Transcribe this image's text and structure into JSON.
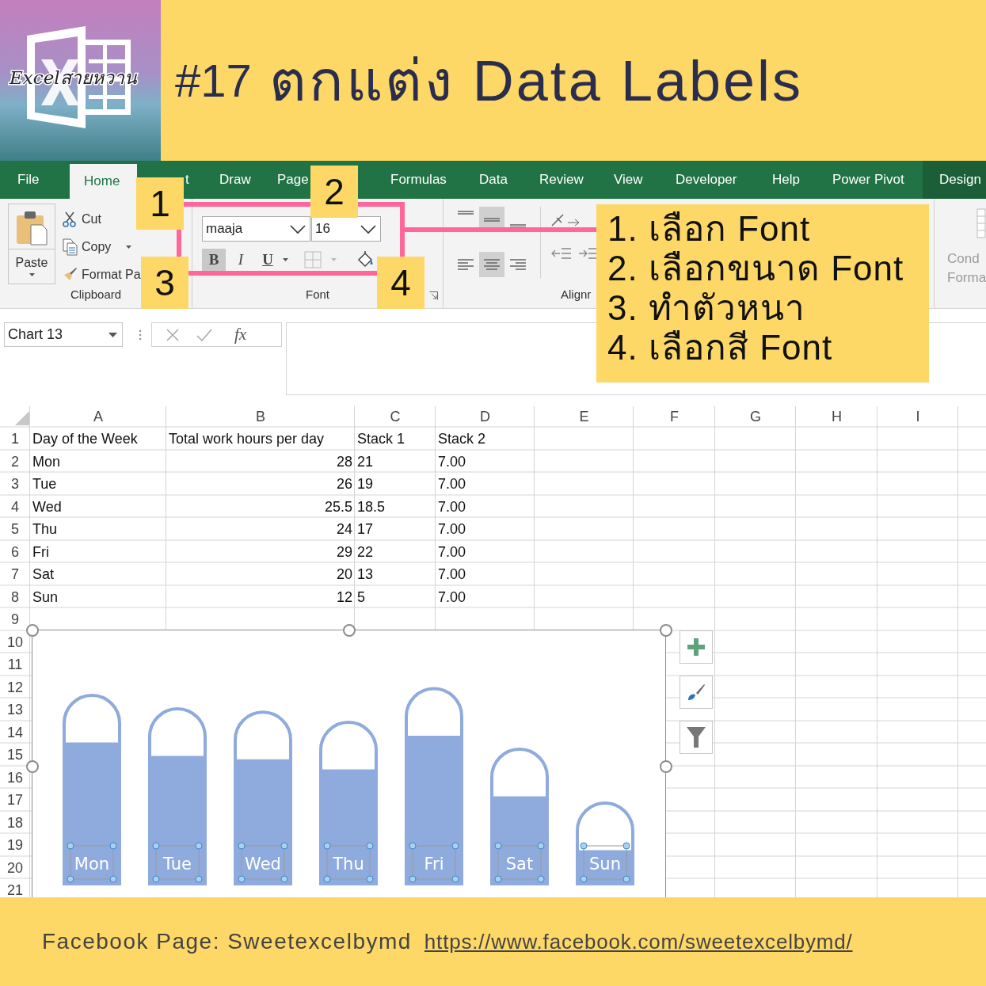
{
  "header": {
    "logo_text": "Excelสายหวาน",
    "number": "#17",
    "title": "ตกแต่ง Data Labels"
  },
  "ribbon": {
    "tabs": [
      {
        "label": "File",
        "selected": false,
        "contextual": false
      },
      {
        "label": "Home",
        "selected": true,
        "contextual": false
      },
      {
        "label": "t",
        "selected": false,
        "contextual": false
      },
      {
        "label": "Draw",
        "selected": false,
        "contextual": false
      },
      {
        "label": "Page",
        "selected": false,
        "contextual": false
      },
      {
        "label": "Formulas",
        "selected": false,
        "contextual": false
      },
      {
        "label": "Data",
        "selected": false,
        "contextual": false
      },
      {
        "label": "Review",
        "selected": false,
        "contextual": false
      },
      {
        "label": "View",
        "selected": false,
        "contextual": false
      },
      {
        "label": "Developer",
        "selected": false,
        "contextual": false
      },
      {
        "label": "Help",
        "selected": false,
        "contextual": false
      },
      {
        "label": "Power Pivot",
        "selected": false,
        "contextual": false
      },
      {
        "label": "Design",
        "selected": false,
        "contextual": true
      }
    ],
    "clipboard": {
      "paste": "Paste",
      "cut": "Cut",
      "copy": "Copy",
      "format_painter": "Format Pa",
      "label": "Clipboard"
    },
    "font": {
      "font_name": "maaja",
      "font_size": "16",
      "format_buttons": [
        {
          "label": "B",
          "selected": true
        },
        {
          "label": "I",
          "selected": false
        },
        {
          "label": "U",
          "selected": false
        }
      ],
      "label": "Font"
    },
    "alignment": {
      "label": "Alignr",
      "align_buttons": [
        {
          "selected": false
        },
        {
          "selected": true
        },
        {
          "selected": false
        },
        {
          "selected": false
        },
        {
          "selected": true
        },
        {
          "selected": false
        }
      ]
    },
    "styles": {
      "lines": [
        "Cond",
        "Forma"
      ]
    }
  },
  "callouts": [
    "1",
    "2",
    "3",
    "4"
  ],
  "instructions": [
    "1. เลือก Font",
    "2. เลือกขนาด Font",
    "3. ทำตัวหนา",
    "4. เลือกสี Font"
  ],
  "formula_bar": {
    "name_box": "Chart 13",
    "function_label": "fx"
  },
  "sheet": {
    "columns": [
      "A",
      "B",
      "C",
      "D",
      "E",
      "F",
      "G",
      "H",
      "I"
    ],
    "rows": [
      {
        "number": "1",
        "kind": "header",
        "cells": [
          "Day of the Week",
          "Total work hours per day",
          "Stack 1",
          "Stack 2"
        ]
      },
      {
        "number": "2",
        "kind": "data",
        "cells": [
          "Mon",
          "28",
          "21",
          "7.00"
        ]
      },
      {
        "number": "3",
        "kind": "data",
        "cells": [
          "Tue",
          "26",
          "19",
          "7.00"
        ]
      },
      {
        "number": "4",
        "kind": "data",
        "cells": [
          "Wed",
          "25.5",
          "18.5",
          "7.00"
        ]
      },
      {
        "number": "5",
        "kind": "data",
        "cells": [
          "Thu",
          "24",
          "17",
          "7.00"
        ]
      },
      {
        "number": "6",
        "kind": "data",
        "cells": [
          "Fri",
          "29",
          "22",
          "7.00"
        ]
      },
      {
        "number": "7",
        "kind": "data",
        "cells": [
          "Sat",
          "20",
          "13",
          "7.00"
        ]
      },
      {
        "number": "8",
        "kind": "data",
        "cells": [
          "Sun",
          "12",
          "5",
          "7.00"
        ]
      },
      {
        "number": "9"
      },
      {
        "number": "10"
      },
      {
        "number": "11"
      },
      {
        "number": "12"
      },
      {
        "number": "13"
      },
      {
        "number": "14"
      },
      {
        "number": "15"
      },
      {
        "number": "16"
      },
      {
        "number": "17"
      },
      {
        "number": "18"
      },
      {
        "number": "19"
      },
      {
        "number": "20"
      },
      {
        "number": "21"
      }
    ]
  },
  "chart": {
    "data_labels": [
      "Mon",
      "Tue",
      "Wed",
      "Thu",
      "Fri",
      "Sat",
      "Sun"
    ]
  },
  "footer": {
    "text": "Facebook Page: Sweetexcelbymd",
    "link": "https://www.facebook.com/sweetexcelbymd/"
  }
}
